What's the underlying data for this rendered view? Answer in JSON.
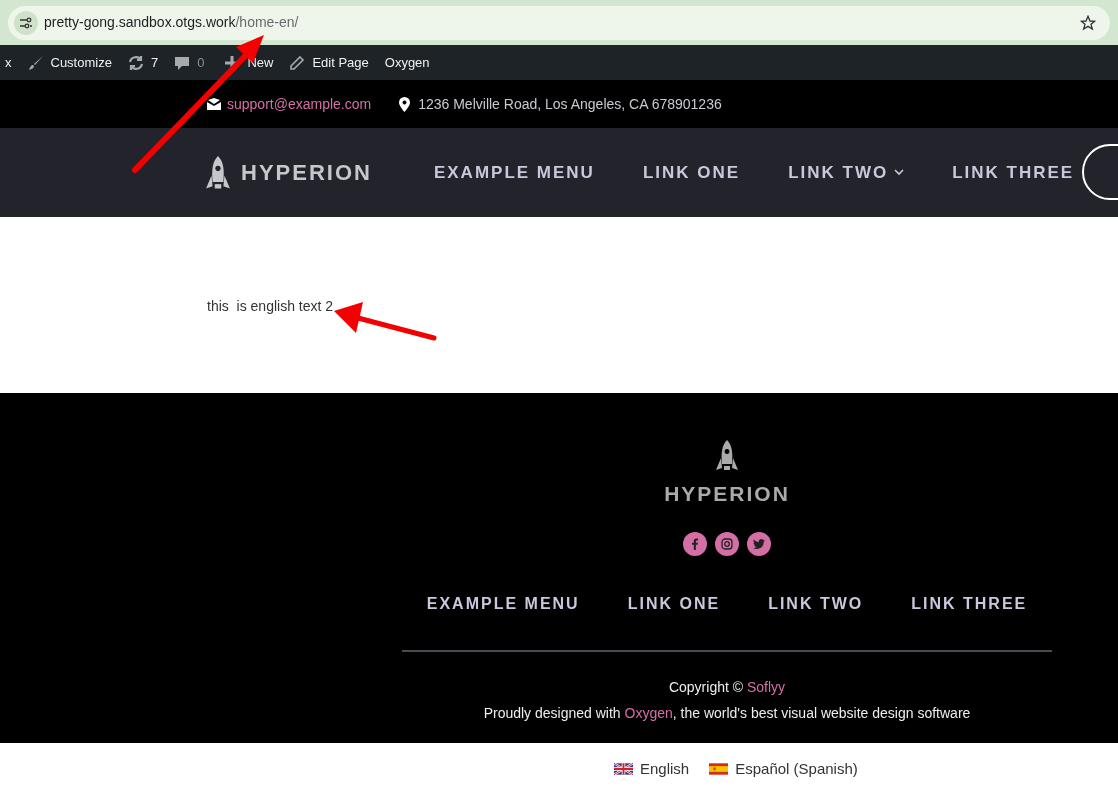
{
  "browser": {
    "url_host": "pretty-gong.sandbox.otgs.work",
    "url_path": "/home-en/"
  },
  "admin_bar": [
    {
      "kind": "text",
      "label": "x"
    },
    {
      "kind": "brush",
      "label": "Customize"
    },
    {
      "kind": "updates",
      "label": "7"
    },
    {
      "kind": "comments",
      "label": "0"
    },
    {
      "kind": "new",
      "label": "New"
    },
    {
      "kind": "edit",
      "label": "Edit Page"
    },
    {
      "kind": "text",
      "label": "Oxygen"
    }
  ],
  "top_bar": {
    "email": "support@example.com",
    "address": "1236 Melville Road, Los Angeles, CA 678901236"
  },
  "header": {
    "logo": "HYPERION",
    "menu": [
      {
        "label": "EXAMPLE MENU",
        "dropdown": false
      },
      {
        "label": "LINK ONE",
        "dropdown": false
      },
      {
        "label": "LINK TWO",
        "dropdown": true
      },
      {
        "label": "LINK THREE",
        "dropdown": false
      }
    ]
  },
  "content": {
    "text": "this  is english text 2"
  },
  "footer": {
    "logo": "HYPERION",
    "social": [
      {
        "kind": "facebook"
      },
      {
        "kind": "instagram"
      },
      {
        "kind": "twitter"
      }
    ],
    "menu": [
      "EXAMPLE MENU",
      "LINK ONE",
      "LINK TWO",
      "LINK THREE"
    ],
    "copyright": "Copyright ©",
    "copyright_link": "Soflyy",
    "credit_before": "Proudly designed with",
    "credit_link": "Oxygen",
    "credit_after": ", the world's best visual website design software"
  },
  "languages": [
    {
      "kind": "uk",
      "label": "English"
    },
    {
      "kind": "es",
      "label": "Español (Spanish)"
    }
  ]
}
